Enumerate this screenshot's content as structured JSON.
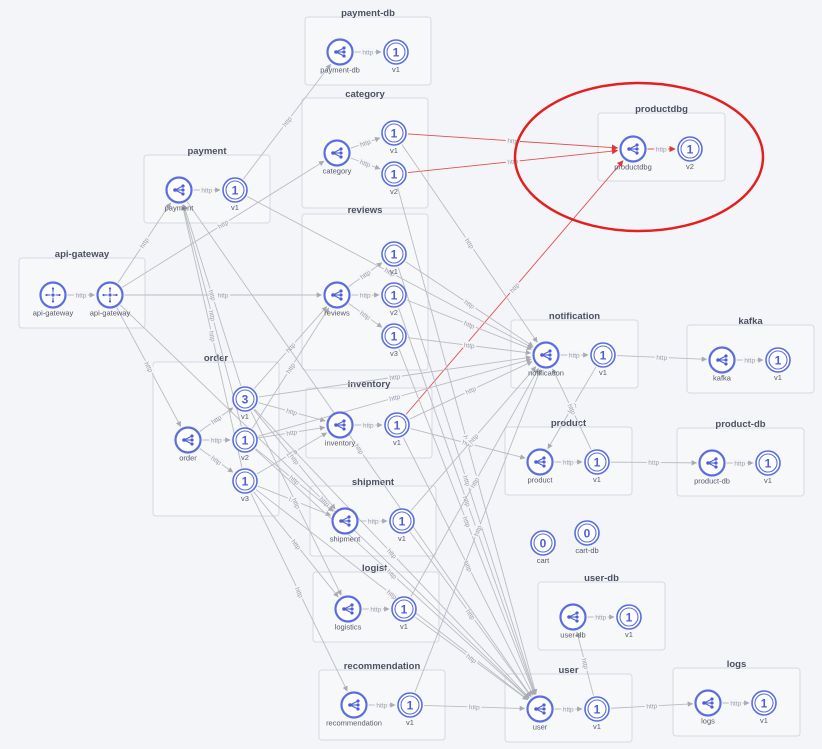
{
  "edge_label": "http",
  "colors": {
    "node": "#5b6ee0",
    "edge": "#b9bcc3",
    "highlight_edge": "#e05050",
    "annotation": "#e32020"
  },
  "groups": [
    {
      "id": "payment-db",
      "title": "payment-db"
    },
    {
      "id": "category",
      "title": "category"
    },
    {
      "id": "payment",
      "title": "payment"
    },
    {
      "id": "productdbg",
      "title": "productdbg"
    },
    {
      "id": "reviews",
      "title": "reviews"
    },
    {
      "id": "api-gateway",
      "title": "api-gateway"
    },
    {
      "id": "notification",
      "title": "notification"
    },
    {
      "id": "kafka",
      "title": "kafka"
    },
    {
      "id": "order",
      "title": "order"
    },
    {
      "id": "inventory",
      "title": "inventory"
    },
    {
      "id": "product",
      "title": "product"
    },
    {
      "id": "product-db",
      "title": "product-db"
    },
    {
      "id": "shipment",
      "title": "shipment"
    },
    {
      "id": "user-db",
      "title": "user-db"
    },
    {
      "id": "logistics",
      "title": "logist."
    },
    {
      "id": "recommendation",
      "title": "recommendation"
    },
    {
      "id": "user",
      "title": "user"
    },
    {
      "id": "logs",
      "title": "logs"
    }
  ],
  "nodes": [
    {
      "id": "payment-db",
      "kind": "service",
      "label": "payment-db",
      "icon": "share-icon"
    },
    {
      "id": "payment-db-v1",
      "kind": "version",
      "label": "v1",
      "count": "1"
    },
    {
      "id": "category",
      "kind": "service",
      "label": "category",
      "icon": "share-icon"
    },
    {
      "id": "category-v1",
      "kind": "version",
      "label": "v1",
      "count": "1"
    },
    {
      "id": "category-v2",
      "kind": "version",
      "label": "v2",
      "count": "1"
    },
    {
      "id": "payment",
      "kind": "service",
      "label": "payment",
      "icon": "share-icon"
    },
    {
      "id": "payment-v1",
      "kind": "version",
      "label": "v1",
      "count": "1"
    },
    {
      "id": "productdbg",
      "kind": "service",
      "label": "productdbg",
      "icon": "share-icon"
    },
    {
      "id": "productdbg-v2",
      "kind": "version",
      "label": "v2",
      "count": "1"
    },
    {
      "id": "reviews",
      "kind": "service",
      "label": "reviews",
      "icon": "share-icon"
    },
    {
      "id": "reviews-v1",
      "kind": "version",
      "label": "v1",
      "count": "1"
    },
    {
      "id": "reviews-v2",
      "kind": "version",
      "label": "v2",
      "count": "1"
    },
    {
      "id": "reviews-v3",
      "kind": "version",
      "label": "v3",
      "count": "1"
    },
    {
      "id": "api-gateway",
      "kind": "service",
      "label": "api-gateway",
      "icon": "gateway-icon"
    },
    {
      "id": "api-gateway-w",
      "kind": "service",
      "label": "api-gateway",
      "icon": "gateway-icon"
    },
    {
      "id": "notification",
      "kind": "service",
      "label": "notification",
      "icon": "share-icon"
    },
    {
      "id": "notification-v1",
      "kind": "version",
      "label": "v1",
      "count": "1"
    },
    {
      "id": "kafka",
      "kind": "service",
      "label": "kafka",
      "icon": "share-icon"
    },
    {
      "id": "kafka-v1",
      "kind": "version",
      "label": "v1",
      "count": "1"
    },
    {
      "id": "order",
      "kind": "service",
      "label": "order",
      "icon": "share-icon"
    },
    {
      "id": "order-v1",
      "kind": "version",
      "label": "v1",
      "count": "3"
    },
    {
      "id": "order-v2",
      "kind": "version",
      "label": "v2",
      "count": "1"
    },
    {
      "id": "order-v3",
      "kind": "version",
      "label": "v3",
      "count": "1"
    },
    {
      "id": "inventory",
      "kind": "service",
      "label": "inventory",
      "icon": "share-icon"
    },
    {
      "id": "inventory-v1",
      "kind": "version",
      "label": "v1",
      "count": "1"
    },
    {
      "id": "product",
      "kind": "service",
      "label": "product",
      "icon": "share-icon"
    },
    {
      "id": "product-v1",
      "kind": "version",
      "label": "v1",
      "count": "1"
    },
    {
      "id": "product-db",
      "kind": "service",
      "label": "product-db",
      "icon": "share-icon"
    },
    {
      "id": "product-db-v1",
      "kind": "version",
      "label": "v1",
      "count": "1"
    },
    {
      "id": "shipment",
      "kind": "service",
      "label": "shipment",
      "icon": "share-icon"
    },
    {
      "id": "shipment-v1",
      "kind": "version",
      "label": "v1",
      "count": "1"
    },
    {
      "id": "cart",
      "kind": "version",
      "label": "cart",
      "count": "0"
    },
    {
      "id": "cart-db",
      "kind": "version",
      "label": "cart-db",
      "count": "0"
    },
    {
      "id": "user-db",
      "kind": "service",
      "label": "user-db",
      "icon": "share-icon"
    },
    {
      "id": "user-db-v1",
      "kind": "version",
      "label": "v1",
      "count": "1"
    },
    {
      "id": "logistics",
      "kind": "service",
      "label": "logistics",
      "icon": "share-icon"
    },
    {
      "id": "logistics-v1",
      "kind": "version",
      "label": "v1",
      "count": "1"
    },
    {
      "id": "recommendation",
      "kind": "service",
      "label": "recommendation",
      "icon": "share-icon"
    },
    {
      "id": "recommendation-v1",
      "kind": "version",
      "label": "v1",
      "count": "1"
    },
    {
      "id": "user",
      "kind": "service",
      "label": "user",
      "icon": "share-icon"
    },
    {
      "id": "user-v1",
      "kind": "version",
      "label": "v1",
      "count": "1"
    },
    {
      "id": "logs",
      "kind": "service",
      "label": "logs",
      "icon": "share-icon"
    },
    {
      "id": "logs-v1",
      "kind": "version",
      "label": "v1",
      "count": "1"
    }
  ],
  "edges": [
    {
      "from": "payment-db",
      "to": "payment-db-v1",
      "label": "http"
    },
    {
      "from": "category",
      "to": "category-v1",
      "label": "http"
    },
    {
      "from": "category",
      "to": "category-v2",
      "label": "http"
    },
    {
      "from": "payment",
      "to": "payment-v1",
      "label": "http"
    },
    {
      "from": "productdbg",
      "to": "productdbg-v2",
      "label": "http",
      "red": true
    },
    {
      "from": "reviews",
      "to": "reviews-v1",
      "label": "http"
    },
    {
      "from": "reviews",
      "to": "reviews-v2",
      "label": "http"
    },
    {
      "from": "reviews",
      "to": "reviews-v3",
      "label": "http"
    },
    {
      "from": "api-gateway",
      "to": "api-gateway-w",
      "label": "http"
    },
    {
      "from": "notification",
      "to": "notification-v1",
      "label": "http"
    },
    {
      "from": "kafka",
      "to": "kafka-v1",
      "label": "http"
    },
    {
      "from": "order",
      "to": "order-v1",
      "label": "http"
    },
    {
      "from": "order",
      "to": "order-v2",
      "label": "http"
    },
    {
      "from": "order",
      "to": "order-v3",
      "label": "http"
    },
    {
      "from": "inventory",
      "to": "inventory-v1",
      "label": "http"
    },
    {
      "from": "product",
      "to": "product-v1",
      "label": "http"
    },
    {
      "from": "product-db",
      "to": "product-db-v1",
      "label": "http"
    },
    {
      "from": "shipment",
      "to": "shipment-v1",
      "label": "http"
    },
    {
      "from": "user-db",
      "to": "user-db-v1",
      "label": "http"
    },
    {
      "from": "logistics",
      "to": "logistics-v1",
      "label": "http"
    },
    {
      "from": "user",
      "to": "user-v1",
      "label": "http"
    },
    {
      "from": "logs",
      "to": "logs-v1",
      "label": "http"
    },
    {
      "from": "recommendation",
      "to": "recommendation-v1",
      "label": "http"
    },
    {
      "from": "category-v1",
      "to": "productdbg",
      "label": "http",
      "red": true
    },
    {
      "from": "category-v2",
      "to": "productdbg",
      "label": "http",
      "red": true
    },
    {
      "from": "inventory-v1",
      "to": "productdbg",
      "label": "http",
      "red": true
    },
    {
      "from": "api-gateway-w",
      "to": "payment",
      "label": "http"
    },
    {
      "from": "api-gateway-w",
      "to": "category",
      "label": "http"
    },
    {
      "from": "api-gateway-w",
      "to": "reviews",
      "label": "http"
    },
    {
      "from": "api-gateway-w",
      "to": "order",
      "label": "http"
    },
    {
      "from": "api-gateway-w",
      "to": "user",
      "label": "http"
    },
    {
      "from": "payment-v1",
      "to": "payment-db",
      "label": "http"
    },
    {
      "from": "payment-v1",
      "to": "notification",
      "label": "http"
    },
    {
      "from": "reviews-v1",
      "to": "notification",
      "label": "http"
    },
    {
      "from": "reviews-v2",
      "to": "notification",
      "label": "http"
    },
    {
      "from": "reviews-v3",
      "to": "notification",
      "label": "http"
    },
    {
      "from": "reviews-v1",
      "to": "user",
      "label": "http"
    },
    {
      "from": "reviews-v2",
      "to": "user",
      "label": "http"
    },
    {
      "from": "reviews-v3",
      "to": "user",
      "label": "http"
    },
    {
      "from": "category-v1",
      "to": "notification",
      "label": "http"
    },
    {
      "from": "category-v2",
      "to": "user",
      "label": "http"
    },
    {
      "from": "notification-v1",
      "to": "kafka",
      "label": "http"
    },
    {
      "from": "notification-v1",
      "to": "product",
      "label": "http"
    },
    {
      "from": "order-v1",
      "to": "payment",
      "label": "http"
    },
    {
      "from": "order-v2",
      "to": "payment",
      "label": "http"
    },
    {
      "from": "order-v3",
      "to": "payment",
      "label": "http"
    },
    {
      "from": "order-v1",
      "to": "reviews",
      "label": "http"
    },
    {
      "from": "order-v2",
      "to": "reviews",
      "label": "http"
    },
    {
      "from": "order-v1",
      "to": "inventory",
      "label": "http"
    },
    {
      "from": "order-v2",
      "to": "inventory",
      "label": "http"
    },
    {
      "from": "order-v3",
      "to": "inventory",
      "label": "http"
    },
    {
      "from": "order-v1",
      "to": "shipment",
      "label": "http"
    },
    {
      "from": "order-v2",
      "to": "shipment",
      "label": "http"
    },
    {
      "from": "order-v3",
      "to": "shipment",
      "label": "http"
    },
    {
      "from": "order-v1",
      "to": "logistics",
      "label": "http"
    },
    {
      "from": "order-v3",
      "to": "logistics",
      "label": "http"
    },
    {
      "from": "order-v1",
      "to": "notification",
      "label": "http"
    },
    {
      "from": "order-v2",
      "to": "notification",
      "label": "http"
    },
    {
      "from": "order-v1",
      "to": "user",
      "label": "http"
    },
    {
      "from": "order-v2",
      "to": "user",
      "label": "http"
    },
    {
      "from": "order-v3",
      "to": "user",
      "label": "http"
    },
    {
      "from": "order-v3",
      "to": "recommendation",
      "label": "http"
    },
    {
      "from": "inventory-v1",
      "to": "product",
      "label": "http"
    },
    {
      "from": "inventory-v1",
      "to": "notification",
      "label": "http"
    },
    {
      "from": "inventory-v1",
      "to": "user",
      "label": "http"
    },
    {
      "from": "product-v1",
      "to": "product-db",
      "label": "http"
    },
    {
      "from": "product-v1",
      "to": "notification",
      "label": "http"
    },
    {
      "from": "shipment-v1",
      "to": "notification",
      "label": "http"
    },
    {
      "from": "shipment-v1",
      "to": "user",
      "label": "http"
    },
    {
      "from": "logistics-v1",
      "to": "notification",
      "label": "http"
    },
    {
      "from": "logistics-v1",
      "to": "user",
      "label": "http"
    },
    {
      "from": "recommendation-v1",
      "to": "user",
      "label": "http"
    },
    {
      "from": "recommendation-v1",
      "to": "notification",
      "label": "http"
    },
    {
      "from": "user-v1",
      "to": "logs",
      "label": "http"
    },
    {
      "from": "user-v1",
      "to": "user-db",
      "label": "http"
    },
    {
      "from": "payment",
      "to": "user",
      "label": "http"
    }
  ]
}
